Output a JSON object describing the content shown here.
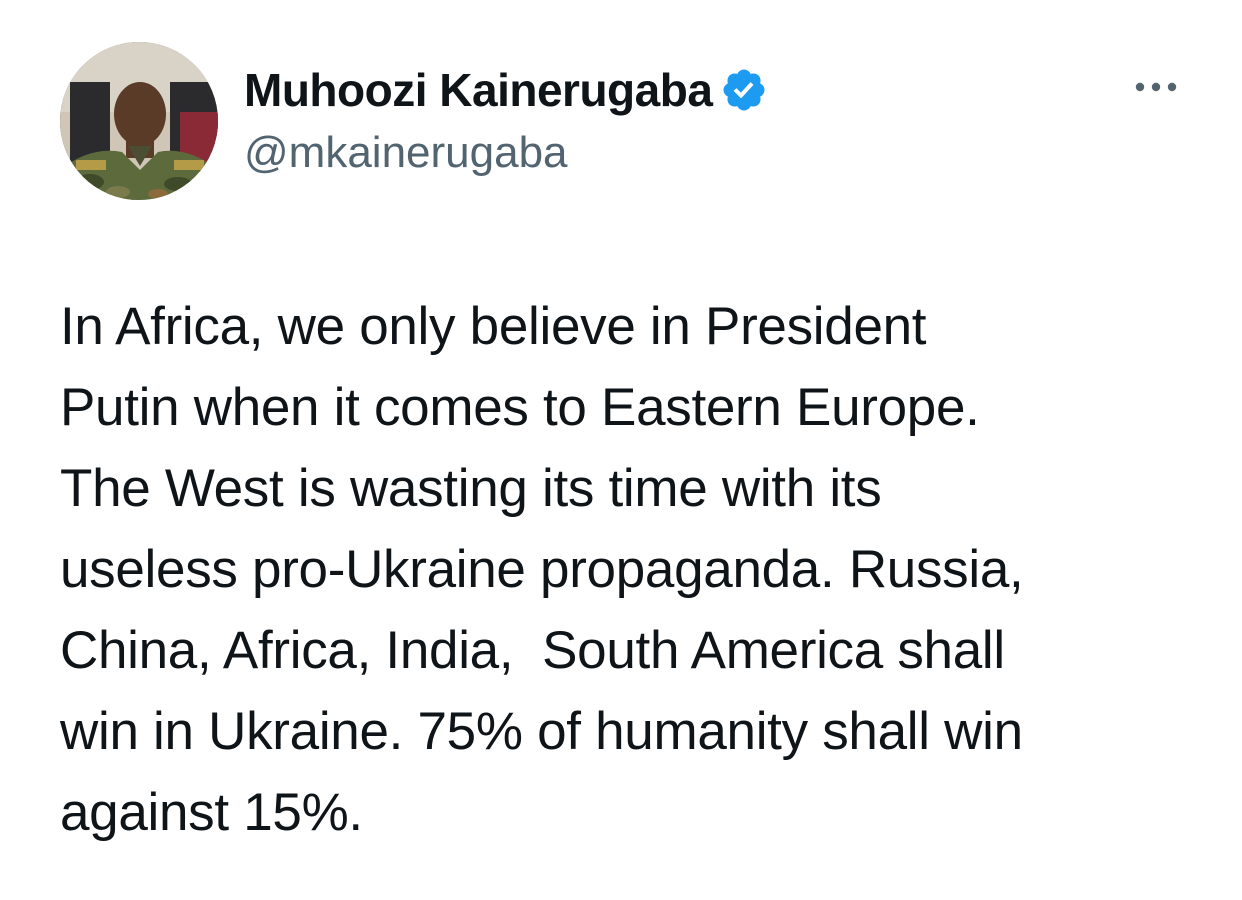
{
  "author": {
    "display_name": "Muhoozi Kainerugaba",
    "handle": "@mkainerugaba",
    "verified": true,
    "avatar": "profile-photo"
  },
  "tweet": {
    "text": "In Africa, we only believe in President\nPutin when it comes to Eastern Europe.\nThe West is wasting its time with its\nuseless pro-Ukraine propaganda. Russia,\nChina, Africa, India,  South America shall\nwin in Ukraine. 75% of humanity shall win\nagainst 15%."
  },
  "icons": {
    "verified": "verified-badge-icon",
    "more": "more-options-icon"
  },
  "colors": {
    "verified_blue": "#1d9bf0",
    "text": "#0f1419",
    "secondary_text": "#536471",
    "background": "#ffffff"
  }
}
